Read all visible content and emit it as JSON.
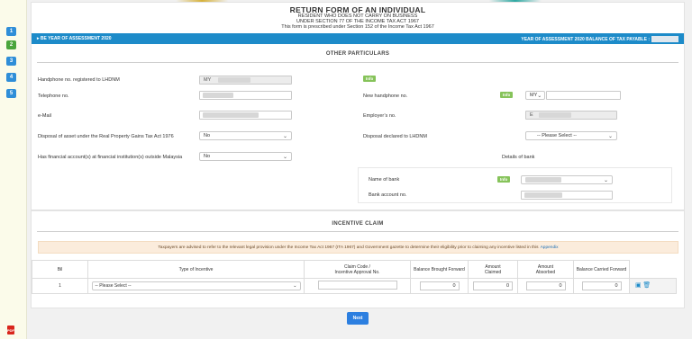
{
  "sidebar": {
    "steps": [
      {
        "label": "1",
        "color": "#2f8ed8"
      },
      {
        "label": "2",
        "color": "#4aa53c"
      },
      {
        "label": "3",
        "color": "#2f8ed8"
      },
      {
        "label": "4",
        "color": "#2f8ed8"
      },
      {
        "label": "5",
        "color": "#2f8ed8"
      }
    ]
  },
  "header": {
    "title": "RETURN FORM OF AN INDIVIDUAL",
    "line1": "RESIDENT WHO DOES NOT CARRY ON BUSINESS",
    "line2": "UNDER SECTION 77 OF THE INCOME TAX ACT 1967",
    "line3": "This form is prescribed under Section 152 of the Income Tax Act 1967",
    "left_bar": "▸ BE YEAR OF ASSESSMENT 2020",
    "right_bar": "YEAR OF ASSESSMENT 2020 BALANCE OF TAX PAYABLE :"
  },
  "other": {
    "section_title": "OTHER PARTICULARS",
    "handphone_label": "Handphone no. registered to LHDNM",
    "handphone_prefix": "MY",
    "info": "Info",
    "telephone_label": "Telephone no.",
    "new_handphone_label": "New handphone no.",
    "new_handphone_prefix": "MY",
    "email_label": "e-Mail",
    "employer_label": "Employer’s no.",
    "employer_prefix": "E",
    "disposal_asset_label": "Disposal of asset under the Real Property Gains Tax Act 1976",
    "disposal_asset_value": "No",
    "disposal_declared_label": "Disposal declared to LHDNM",
    "disposal_declared_value": "-- Please Select --",
    "financial_label": "Has financial account(s) at financial institution(s) outside Malaysia",
    "financial_value": "No",
    "details_bank_title": "Details of bank",
    "name_bank_label": "Name of bank",
    "bank_account_label": "Bank account no."
  },
  "incentive": {
    "section_title": "INCENTIVE CLAIM",
    "alert_text": "Taxpayers are advised to refer to the relevant legal provision under the Income Tax Act 1967 (ITA 1967) and Government gazette to determine their eligibility prior to claiming any incentive listed in this",
    "alert_link": "Appendix",
    "headers": {
      "bil": "Bil",
      "type": "Type of Incentive",
      "claim_code_1": "Claim Code /",
      "claim_code_2": "Incentive Approval No.",
      "brought": "Balance Brought Forward",
      "claimed_1": "Amount",
      "claimed_2": "Claimed",
      "absorbed_1": "Amount",
      "absorbed_2": "Absorbed",
      "carried": "Balance Carried Forward"
    },
    "row": {
      "bil": "1",
      "type": "-- Please Select --",
      "brought": "0",
      "claimed": "0",
      "absorbed": "0",
      "carried": "0"
    }
  },
  "buttons": {
    "next": "Next",
    "pdf": "PDF"
  }
}
